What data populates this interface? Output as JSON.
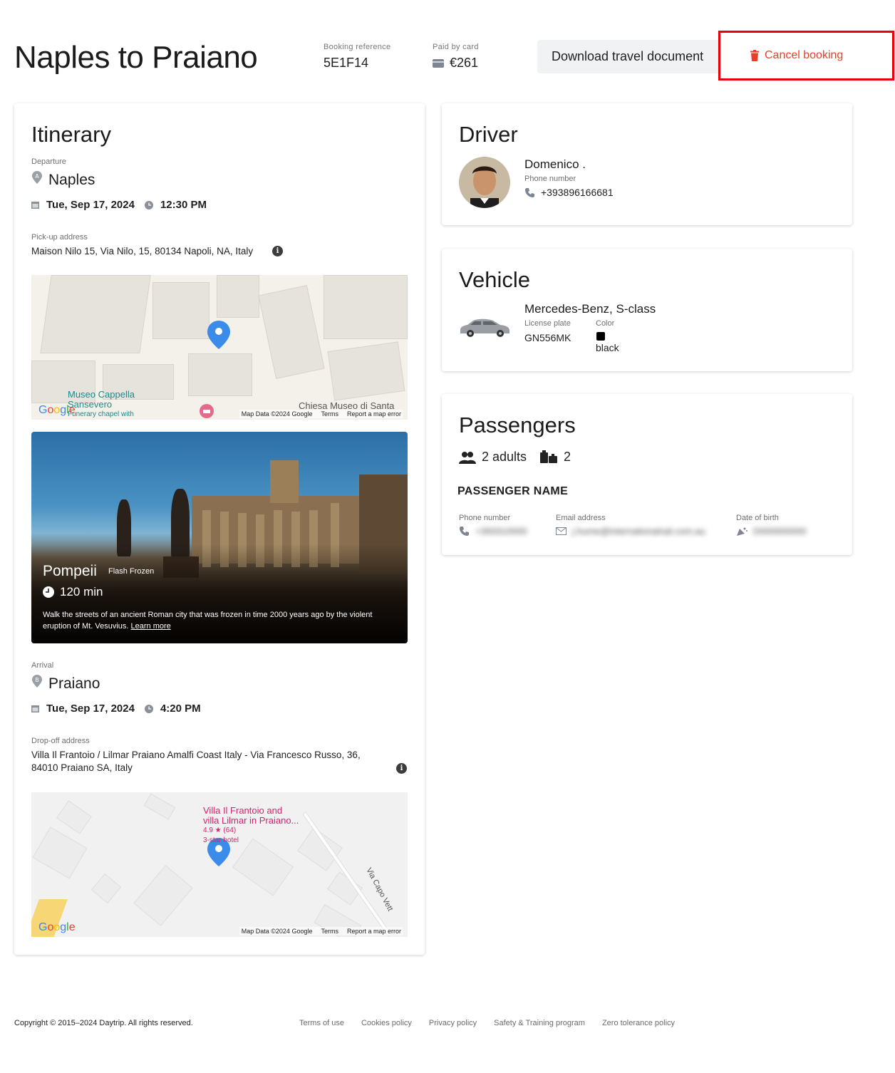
{
  "header": {
    "title": "Naples to Praiano",
    "booking_reference_label": "Booking reference",
    "booking_reference": "5E1F14",
    "paid_label": "Paid by card",
    "paid_amount": "€261",
    "download_label": "Download travel document",
    "cancel_label": "Cancel booking"
  },
  "itinerary": {
    "title": "Itinerary",
    "departure_label": "Departure",
    "departure_place": "Naples",
    "departure_date": "Tue, Sep 17, 2024",
    "departure_time": "12:30 PM",
    "pickup_label": "Pick-up address",
    "pickup_address": "Maison Nilo 15, Via Nilo, 15, 80134 Napoli, NA, Italy",
    "map1": {
      "poi1": "Museo Cappella",
      "poi1b": "Sansevero",
      "poi1c": "Funerary chapel with",
      "poi2": "Chiesa Museo di Santa",
      "footer_data": "Map Data ©2024 Google",
      "footer_terms": "Terms",
      "footer_report": "Report a map error"
    },
    "promo": {
      "title": "Pompeii",
      "tag": "Flash Frozen",
      "duration": "120 min",
      "description": "Walk the streets of an ancient Roman city that was frozen in time 2000 years ago by the violent eruption of Mt. Vesuvius.",
      "link": "Learn more"
    },
    "arrival_label": "Arrival",
    "arrival_place": "Praiano",
    "arrival_date": "Tue, Sep 17, 2024",
    "arrival_time": "4:20 PM",
    "dropoff_label": "Drop-off address",
    "dropoff_address_line1": "Villa Il Frantoio / Lilmar Praiano Amalfi Coast Italy - Via Francesco Russo, 36,",
    "dropoff_address_line2": "84010 Praiano SA, Italy",
    "map2": {
      "poi1": "Villa Il Frantoio and",
      "poi1b": "villa Lilmar in Praiano...",
      "rating": "4.9 ★ (64)",
      "hotel": "3-star hotel",
      "road": "Via Capo Vett",
      "footer_data": "Map Data ©2024 Google",
      "footer_terms": "Terms",
      "footer_report": "Report a map error"
    }
  },
  "driver": {
    "title": "Driver",
    "name": "Domenico .",
    "phone_label": "Phone number",
    "phone": "+393896166681"
  },
  "vehicle": {
    "title": "Vehicle",
    "model": "Mercedes-Benz, S-class",
    "plate_label": "License plate",
    "plate": "GN556MK",
    "color_label": "Color",
    "color": "black"
  },
  "passengers": {
    "title": "Passengers",
    "adults": "2 adults",
    "luggage": "2",
    "name_heading": "PASSENGER NAME",
    "phone_label": "Phone number",
    "phone_value": "+393310000",
    "email_label": "Email address",
    "email_value": "j.hume@internationalrail.com.au",
    "dob_label": "Date of birth",
    "dob_value": "D000000000"
  },
  "footer": {
    "copyright": "Copyright © 2015–2024 Daytrip. All rights reserved.",
    "links": [
      "Terms of use",
      "Cookies policy",
      "Privacy policy",
      "Safety & Training program",
      "Zero tolerance policy"
    ]
  },
  "colors": {
    "cancel_red": "#e5412a",
    "highlight_red": "#e8000b",
    "pin_blue": "#3b8beb",
    "poi_teal": "#1a8a8a",
    "poi_pink": "#d6226b"
  }
}
